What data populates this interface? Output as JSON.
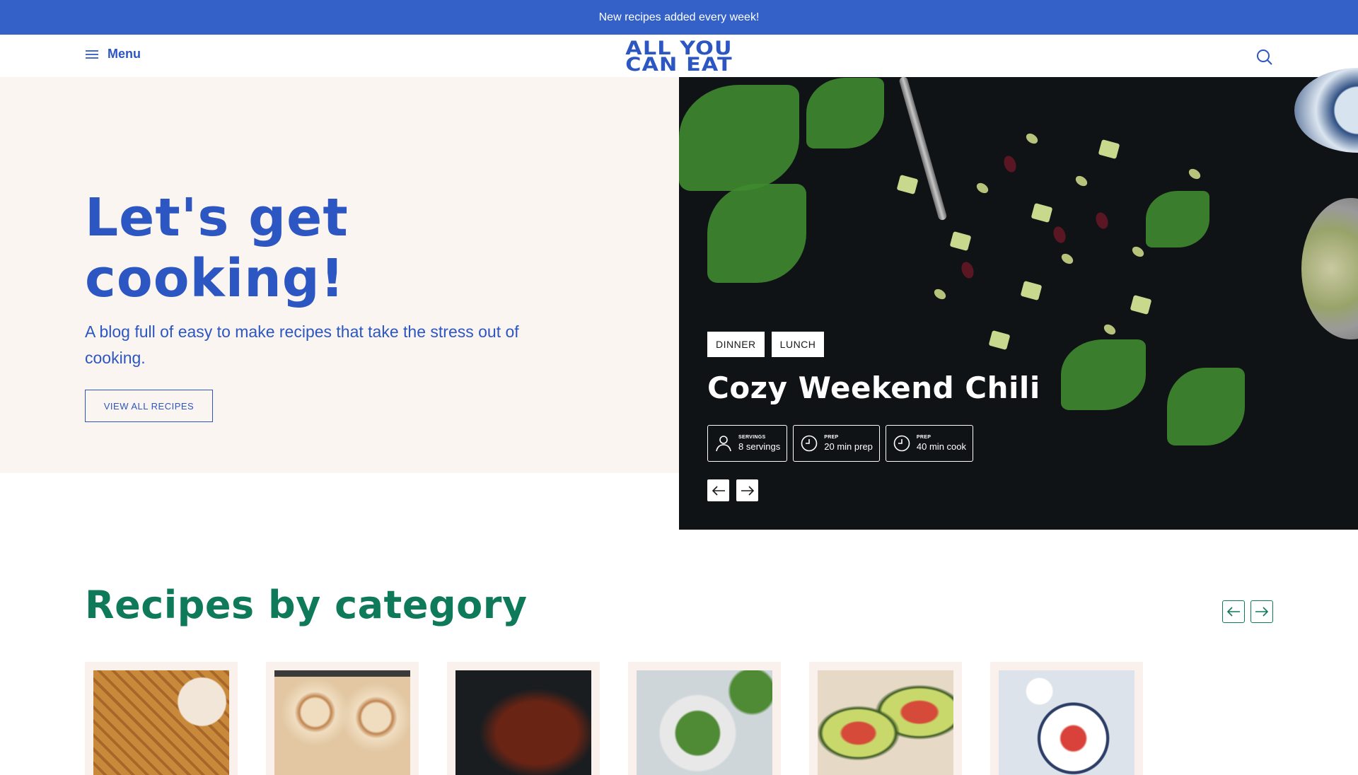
{
  "banner": {
    "text": "New recipes added every week!"
  },
  "header": {
    "menu_label": "Menu",
    "logo_line1": "ALL YOU",
    "logo_line2": "CAN EAT"
  },
  "hero": {
    "title_line1": "Let's get",
    "title_line2": "cooking!",
    "subtitle": "A blog full of easy to make recipes that take the stress out of cooking.",
    "cta_label": "VIEW ALL RECIPES"
  },
  "featured": {
    "tags": [
      "DINNER",
      "LUNCH"
    ],
    "title": "Cozy Weekend Chili",
    "stats": [
      {
        "label": "SERVINGS",
        "value": "8 servings",
        "icon": "person-icon"
      },
      {
        "label": "PREP",
        "value": "20 min prep",
        "icon": "clock-icon"
      },
      {
        "label": "PREP",
        "value": "40 min cook",
        "icon": "clock-icon"
      }
    ]
  },
  "categories": {
    "title": "Recipes by category",
    "cards": [
      {
        "image": "waffles-image"
      },
      {
        "image": "cinnamon-rolls-image"
      },
      {
        "image": "chili-image"
      },
      {
        "image": "salad-image"
      },
      {
        "image": "stuffed-avocado-image"
      },
      {
        "image": "bowl-image"
      }
    ]
  },
  "colors": {
    "banner": "#3461c8",
    "primary_blue": "#2c56c2",
    "hero_bg": "#faf5f1",
    "green": "#0f7a5a",
    "card_bg": "#faf1ec"
  }
}
